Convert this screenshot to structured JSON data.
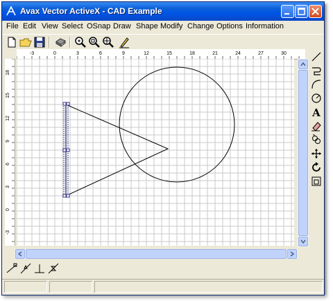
{
  "window": {
    "title": "Avax Vector ActiveX - CAD Example",
    "app_icon": "avax-logo-icon",
    "controls": [
      "minimize-icon",
      "maximize-icon",
      "close-icon"
    ]
  },
  "menu": {
    "items": [
      "File",
      "Edit",
      "View",
      "Select",
      "OSnap",
      "Draw",
      "Shape",
      "Modify",
      "Change",
      "Options",
      "Information"
    ]
  },
  "toolbar": {
    "buttons": [
      "new-file-icon",
      "open-folder-icon",
      "save-disk-icon",
      "print-icon",
      "zoom-icon",
      "zoom-window-icon",
      "zoom-pan-icon",
      "pencil-icon"
    ]
  },
  "rulers": {
    "top_labels": [
      "-3",
      "0",
      "3",
      "6",
      "9",
      "12",
      "15",
      "18",
      "21",
      "24",
      "27",
      "30"
    ],
    "left_labels": [
      "18",
      "15",
      "12",
      "9",
      "6",
      "3",
      "0",
      "-3"
    ]
  },
  "right_toolbar": {
    "buttons": [
      "line-icon",
      "polyline-icon",
      "arc-icon",
      "circle-icon",
      "text-icon",
      "eraser-icon",
      "copy-icon",
      "move-icon",
      "rotate-icon",
      "scale-icon"
    ],
    "text_tool_label": "A"
  },
  "bottom_toolbar": {
    "buttons": [
      "snap-endpoint-icon",
      "snap-midpoint-icon",
      "snap-perpendicular-icon",
      "snap-nearest-icon"
    ]
  },
  "colors": {
    "titlebar": "#0055e5",
    "face": "#ece9d8",
    "grid": "#c8c8c8",
    "shape": "#000000",
    "selection": "#3a3a8c"
  }
}
